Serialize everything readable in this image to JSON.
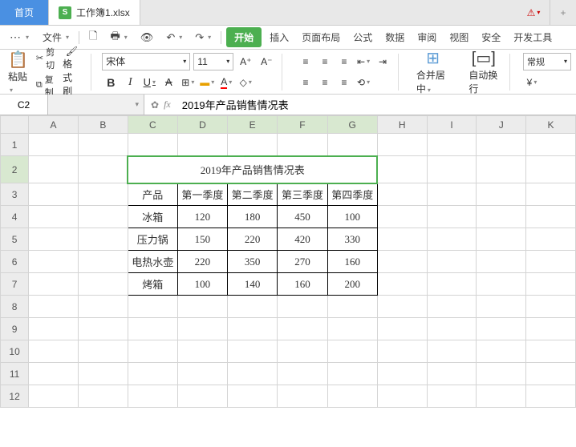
{
  "tabs": {
    "home": "首页",
    "file": "工作簿1.xlsx"
  },
  "menu": {
    "file": "文件",
    "start": "开始",
    "insert": "插入",
    "layout": "页面布局",
    "formula": "公式",
    "data": "数据",
    "review": "审阅",
    "view": "视图",
    "security": "安全",
    "dev": "开发工具"
  },
  "ribbon": {
    "paste": "粘贴",
    "cut": "剪切",
    "copy": "复制",
    "brush": "格式刷",
    "font_name": "宋体",
    "font_size": "11",
    "merge": "合并居中",
    "wrap": "自动换行",
    "num_format": "常规"
  },
  "formula": {
    "cell_ref": "C2",
    "value": "2019年产品销售情况表"
  },
  "cols": [
    "A",
    "B",
    "C",
    "D",
    "E",
    "F",
    "G",
    "H",
    "I",
    "J",
    "K"
  ],
  "rows": [
    "1",
    "2",
    "3",
    "4",
    "5",
    "6",
    "7",
    "8",
    "9",
    "10",
    "11",
    "12"
  ],
  "chart_data": {
    "type": "table",
    "title": "2019年产品销售情况表",
    "columns": [
      "产品",
      "第一季度",
      "第二季度",
      "第三季度",
      "第四季度"
    ],
    "data": [
      {
        "product": "冰箱",
        "q1": 120,
        "q2": 180,
        "q3": 450,
        "q4": 100
      },
      {
        "product": "压力锅",
        "q1": 150,
        "q2": 220,
        "q3": 420,
        "q4": 330
      },
      {
        "product": "电热水壶",
        "q1": 220,
        "q2": 350,
        "q3": 270,
        "q4": 160
      },
      {
        "product": "烤箱",
        "q1": 100,
        "q2": 140,
        "q3": 160,
        "q4": 200
      }
    ]
  }
}
